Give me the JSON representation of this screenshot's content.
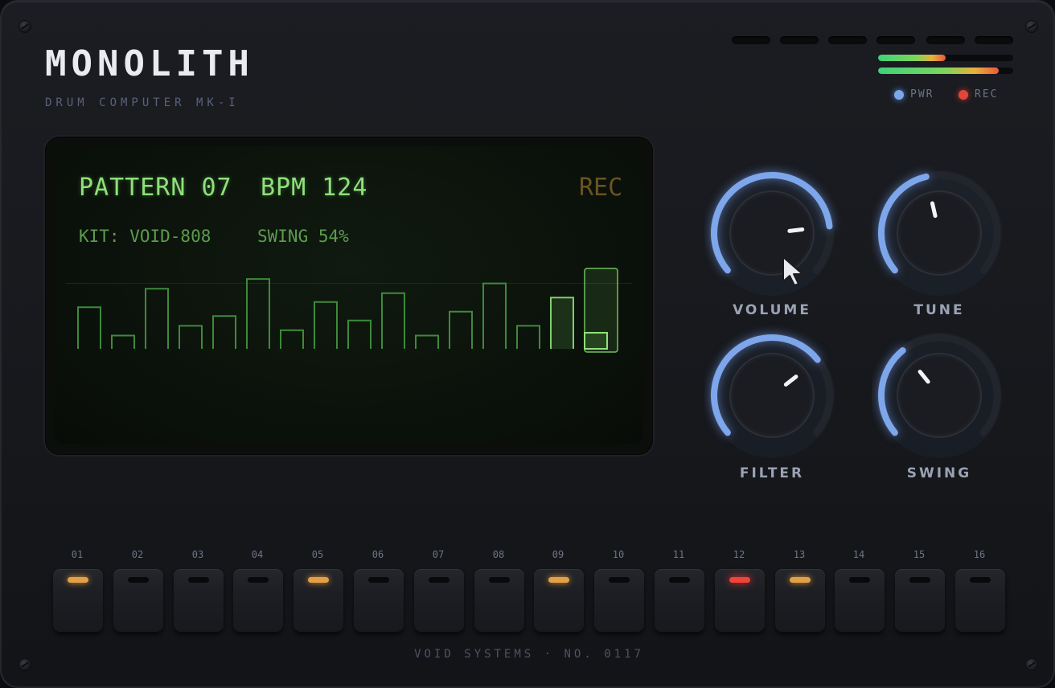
{
  "brand": {
    "name": "MONOLITH",
    "subtitle": "DRUM COMPUTER MK-I"
  },
  "indicators": {
    "pwr": "PWR",
    "rec": "REC"
  },
  "meters": [
    {
      "level": 0.5
    },
    {
      "level": 0.89
    }
  ],
  "colors": {
    "accent": "#7ea6ea",
    "lcd_text": "#8fe07a",
    "amber": "#e2a048",
    "alert": "#f0443a"
  },
  "display": {
    "pattern": "PATTERN 07",
    "bpm": "BPM 124",
    "rec": "REC",
    "kit": "KIT: VOID-808",
    "swing": "SWING 54%",
    "bars": [
      0.47,
      0.15,
      0.68,
      0.26,
      0.37,
      0.79,
      0.21,
      0.53,
      0.32,
      0.63,
      0.15,
      0.42,
      0.74,
      0.26,
      0.58,
      0.2
    ],
    "active_step": 16,
    "highlight_step": 15
  },
  "knobs": [
    {
      "label": "VOLUME",
      "value": 0.82,
      "icon": "volume-knob"
    },
    {
      "label": "TUNE",
      "value": 0.45,
      "icon": "tune-knob"
    },
    {
      "label": "FILTER",
      "value": 0.7,
      "icon": "filter-knob"
    },
    {
      "label": "SWING",
      "value": 0.35,
      "icon": "swing-knob"
    }
  ],
  "steps": [
    {
      "num": "01",
      "state": "amber"
    },
    {
      "num": "02",
      "state": "off"
    },
    {
      "num": "03",
      "state": "off"
    },
    {
      "num": "04",
      "state": "off"
    },
    {
      "num": "05",
      "state": "amber"
    },
    {
      "num": "06",
      "state": "off"
    },
    {
      "num": "07",
      "state": "off"
    },
    {
      "num": "08",
      "state": "off"
    },
    {
      "num": "09",
      "state": "amber"
    },
    {
      "num": "10",
      "state": "off"
    },
    {
      "num": "11",
      "state": "off"
    },
    {
      "num": "12",
      "state": "red"
    },
    {
      "num": "13",
      "state": "amber"
    },
    {
      "num": "14",
      "state": "off"
    },
    {
      "num": "15",
      "state": "off"
    },
    {
      "num": "16",
      "state": "off"
    }
  ],
  "footer": "VOID SYSTEMS · NO. 0117"
}
